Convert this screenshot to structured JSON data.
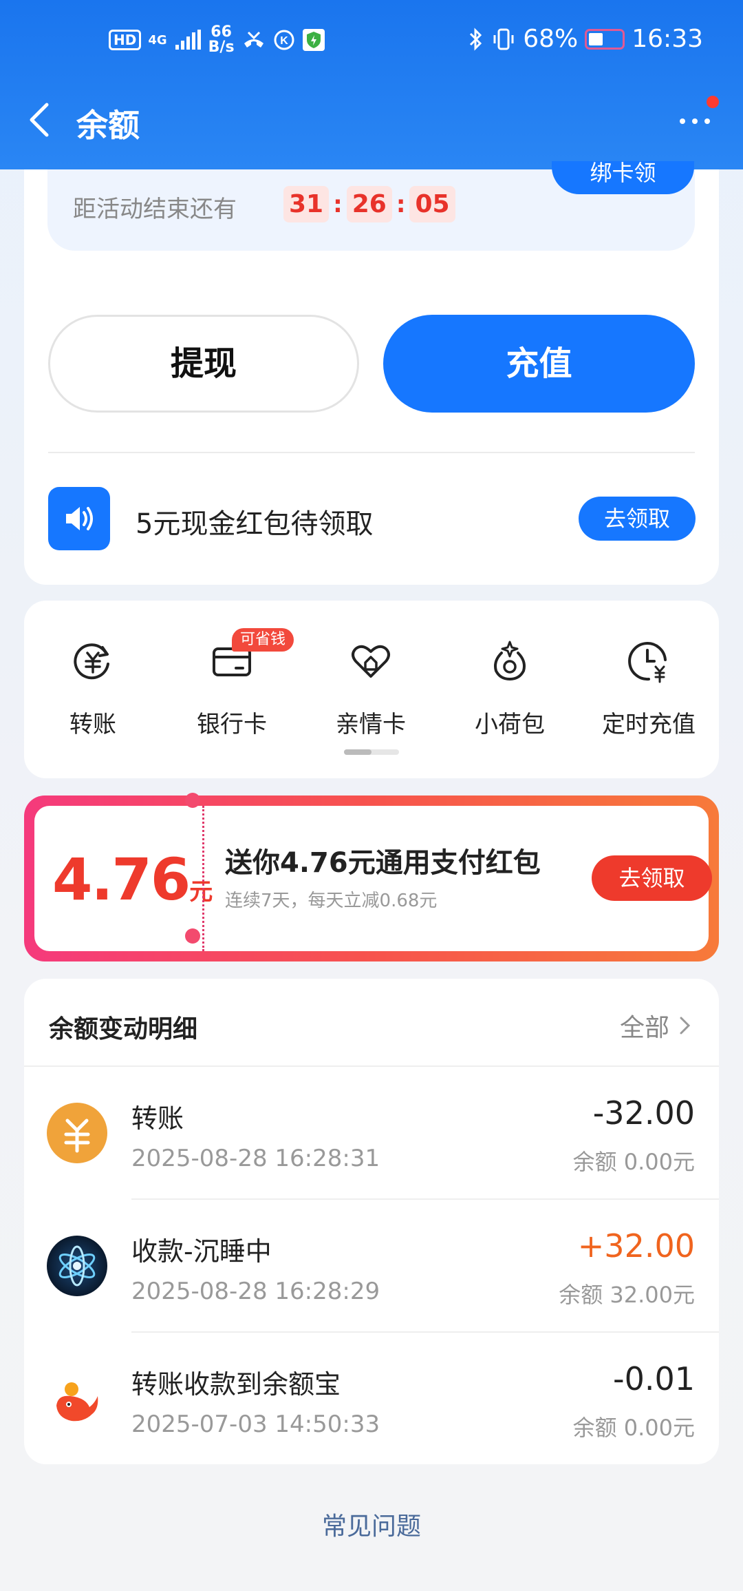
{
  "status_bar": {
    "network": "4G",
    "speed_value": "66",
    "speed_unit": "B/s",
    "battery": "68%",
    "time": "16:33"
  },
  "nav": {
    "title": "余额"
  },
  "promo": {
    "countdown_label": "距活动结束还有",
    "hours": "31",
    "minutes": "26",
    "seconds": "05",
    "bind_button": "绑卡领"
  },
  "actions": {
    "withdraw": "提现",
    "recharge": "充值"
  },
  "red_packet": {
    "text": "5元现金红包待领取",
    "button": "去领取"
  },
  "services": [
    {
      "label": "转账",
      "icon": "transfer-yuan-icon"
    },
    {
      "label": "银行卡",
      "icon": "bank-card-icon",
      "badge": "可省钱"
    },
    {
      "label": "亲情卡",
      "icon": "heart-home-icon"
    },
    {
      "label": "小荷包",
      "icon": "pouch-icon"
    },
    {
      "label": "定时充值",
      "icon": "clock-yuan-icon"
    }
  ],
  "coupon": {
    "amount": "4.76",
    "unit": "元",
    "title": "送你4.76元通用支付红包",
    "subtitle": "连续7天，每天立减0.68元",
    "button": "去领取"
  },
  "records": {
    "title": "余额变动明细",
    "all_link": "全部",
    "items": [
      {
        "title": "转账",
        "time": "2025-08-28 16:28:31",
        "amount": "-32.00",
        "balance": "余额 0.00元"
      },
      {
        "title": "收款-沉睡中",
        "time": "2025-08-28 16:28:29",
        "amount": "+32.00",
        "balance": "余额 32.00元"
      },
      {
        "title": "转账收款到余额宝",
        "time": "2025-07-03 14:50:33",
        "amount": "-0.01",
        "balance": "余额 0.00元"
      }
    ]
  },
  "faq": "常见问题",
  "colors": {
    "primary": "#1677ff",
    "red": "#ee3a2c",
    "positive": "#f0641e"
  }
}
